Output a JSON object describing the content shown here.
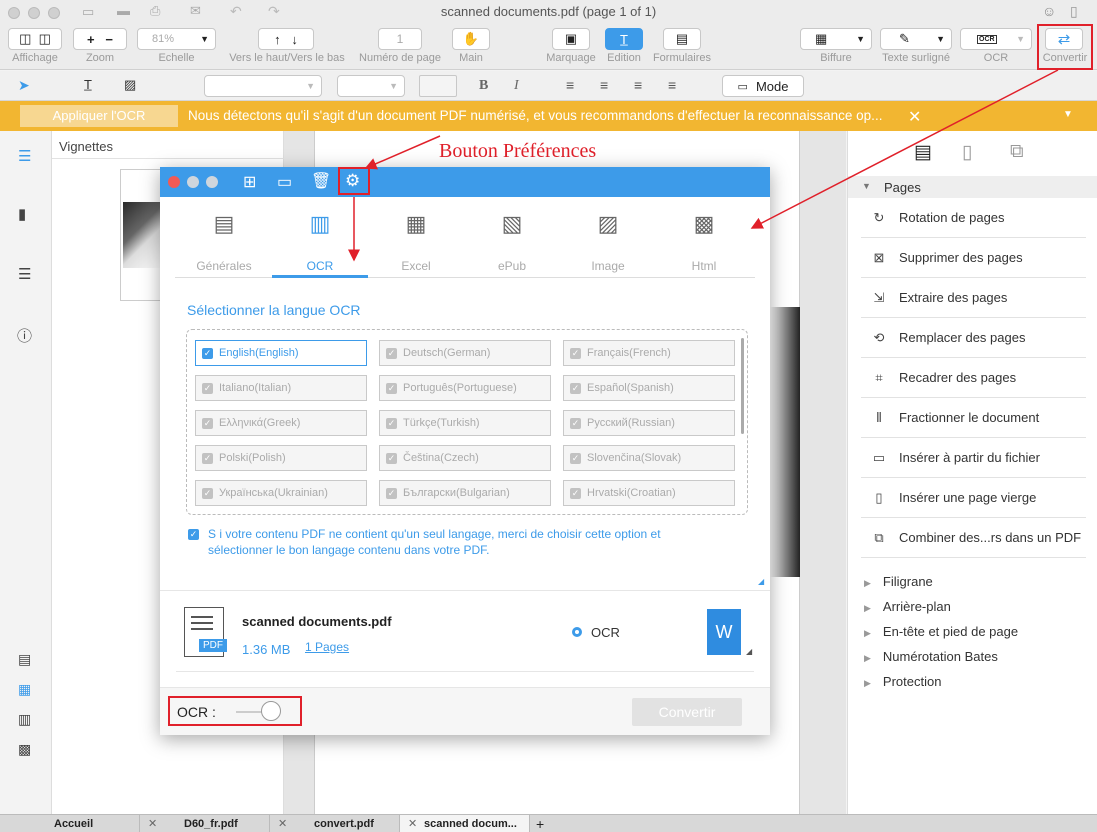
{
  "window": {
    "title": "scanned documents.pdf (page 1 of 1)"
  },
  "toolbar": {
    "affichage": "Affichage",
    "zoom": "Zoom",
    "zoom_value": "81%",
    "echelle": "Echelle",
    "nav": "Vers le haut/Vers le bas",
    "page_number_value": "1",
    "page_number_label": "Numéro de page",
    "main": "Main",
    "marquage": "Marquage",
    "edition": "Edition",
    "formulaires": "Formulaires",
    "biffure": "Biffure",
    "texte_surligne": "Texte surligné",
    "ocr": "OCR",
    "ocr_icon_text": "OCR",
    "convertir": "Convertir"
  },
  "formatbar": {
    "bold": "B",
    "italic": "I",
    "mode": "Mode"
  },
  "banner": {
    "apply_button": "Appliquer l'OCR",
    "message": "Nous détectons qu'il s'agit d'un document PDF numérisé, et vous recommandons d'effectuer la reconnaissance op..."
  },
  "thumbnails": {
    "title": "Vignettes"
  },
  "annotation": {
    "label": "Bouton Préférences"
  },
  "dialog": {
    "tabs": [
      {
        "label": "Générales",
        "icon": "doc-icon"
      },
      {
        "label": "OCR",
        "icon": "ocr-icon"
      },
      {
        "label": "Excel",
        "icon": "excel-icon"
      },
      {
        "label": "ePub",
        "icon": "epub-icon"
      },
      {
        "label": "Image",
        "icon": "image-icon"
      },
      {
        "label": "Html",
        "icon": "html-icon"
      }
    ],
    "section_title": "Sélectionner la langue OCR",
    "languages": [
      "English(English)",
      "Deutsch(German)",
      "Français(French)",
      "Italiano(Italian)",
      "Português(Portuguese)",
      "Español(Spanish)",
      "Ελληνικά(Greek)",
      "Türkçe(Turkish)",
      "Русский(Russian)",
      "Polski(Polish)",
      "Čeština(Czech)",
      "Slovenčina(Slovak)",
      "Українська(Ukrainian)",
      "Български(Bulgarian)",
      "Hrvatski(Croatian)"
    ],
    "note_line1": "S i votre contenu PDF ne contient qu'un seul langage, merci de choisir cette option et",
    "note_line2": "sélectionner le bon langage contenu dans votre PDF.",
    "file": {
      "name": "scanned documents.pdf",
      "size": "1.36 MB",
      "pages": "1 Pages",
      "pdf_badge": "PDF",
      "option": "OCR",
      "word_badge": "W"
    },
    "ocr_toggle_label": "OCR :",
    "convert_button": "Convertir"
  },
  "rightpanel": {
    "pages_header": "Pages",
    "items": [
      "Rotation de pages",
      "Supprimer des pages",
      "Extraire des pages",
      "Remplacer des pages",
      "Recadrer des pages",
      "Fractionner le document",
      "Insérer à partir du fichier",
      "Insérer une page vierge",
      "Combiner des...rs dans un PDF"
    ],
    "sections": [
      "Filigrane",
      "Arrière-plan",
      "En-tête et pied de page",
      "Numérotation Bates",
      "Protection"
    ]
  },
  "tabbar": {
    "tabs": [
      "Accueil",
      "D60_fr.pdf",
      "convert.pdf",
      "scanned docum..."
    ],
    "add": "+"
  },
  "colors": {
    "accent": "#3d9be9",
    "banner": "#f2b631",
    "annotation": "#e0202a"
  }
}
